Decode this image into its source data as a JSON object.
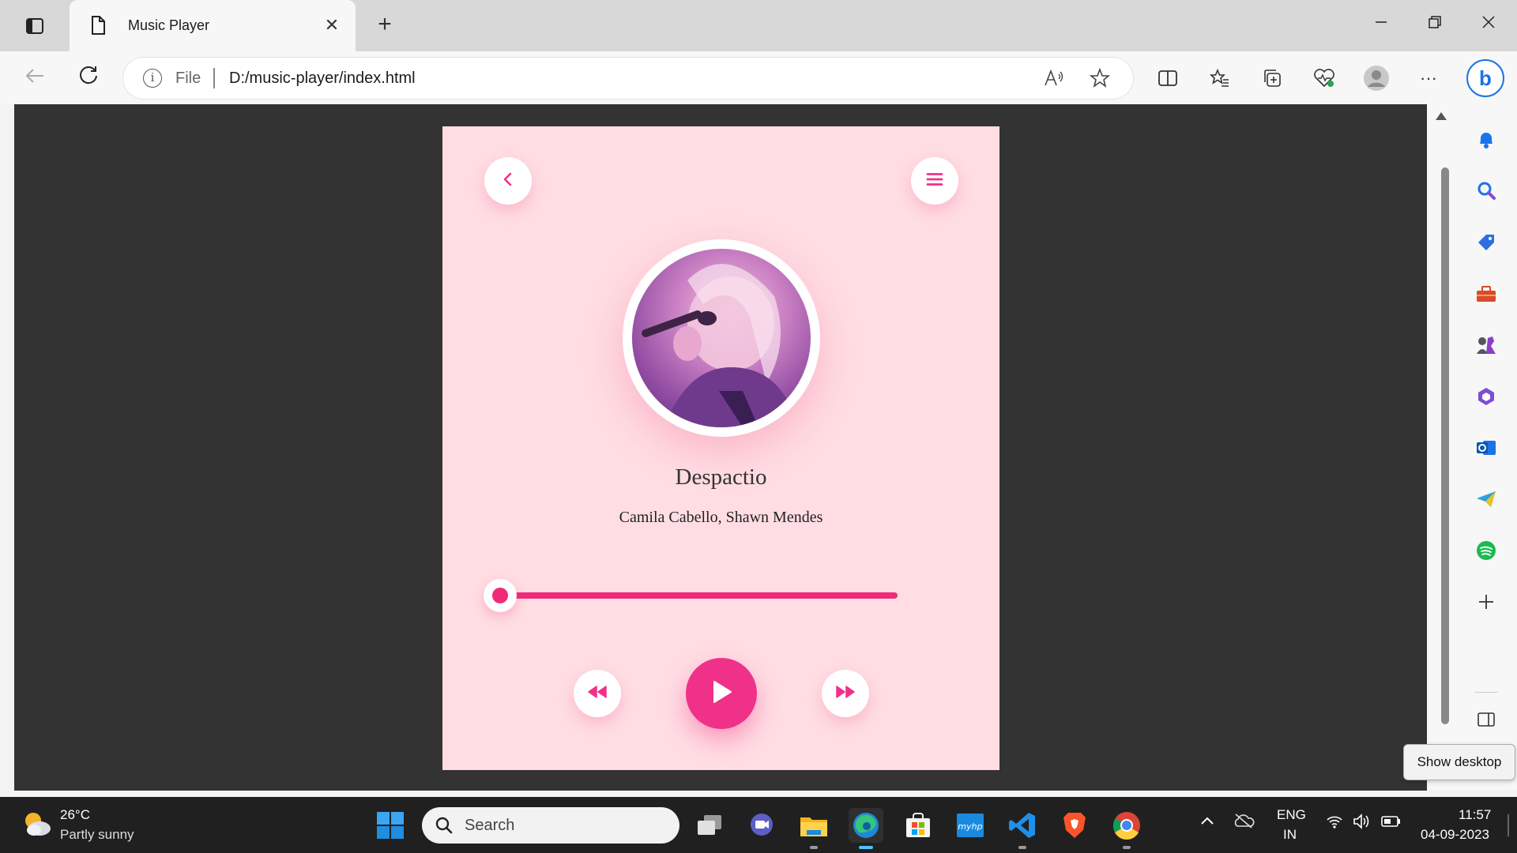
{
  "browser": {
    "tab_title": "Music Player",
    "close_tab_glyph": "✕",
    "new_tab_glyph": "+",
    "url_scheme": "File",
    "url": "D:/music-player/index.html",
    "info_glyph": "i",
    "more_glyph": "···"
  },
  "player": {
    "song_title": "Despactio",
    "song_artist": "Camila Cabello, Shawn Mendes",
    "progress": 0,
    "accent_color": "#f0318a",
    "card_color": "#ffdde3"
  },
  "tooltip": {
    "text": "Show desktop"
  },
  "taskbar": {
    "weather_temp": "26°C",
    "weather_desc": "Partly sunny",
    "search_label": "Search",
    "lang_line1": "ENG",
    "lang_line2": "IN",
    "time": "11:57",
    "date": "04-09-2023"
  },
  "sidebar": {
    "items": [
      "bell-icon",
      "search-icon",
      "shopping-tag-icon",
      "tools-icon",
      "games-icon",
      "office-icon",
      "outlook-icon",
      "telegram-icon",
      "spotify-icon",
      "add-icon"
    ]
  }
}
